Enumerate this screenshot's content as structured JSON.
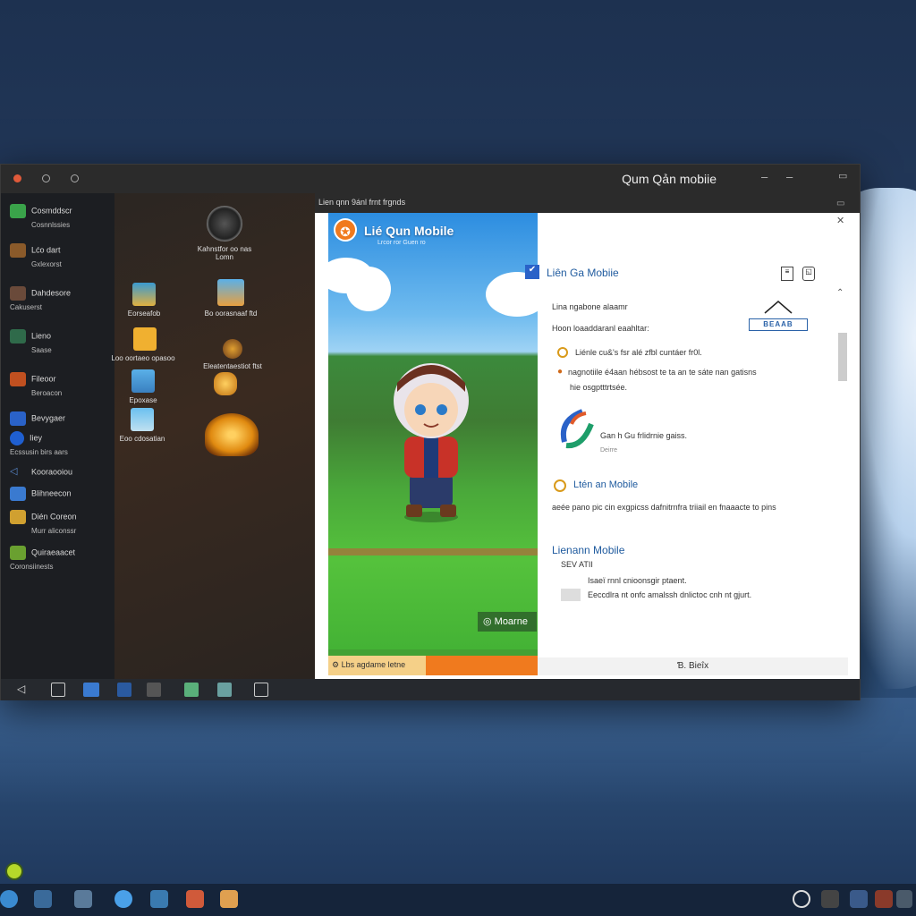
{
  "window": {
    "title": "Qum Qản mobiie"
  },
  "content_bar": {
    "text": "Lien qnn 9ánl frnt frgnds"
  },
  "sidebar": {
    "items": [
      {
        "label": "Cosmddscr",
        "sub": "Cosnnlssies"
      },
      {
        "label": "Lćo dart",
        "sub": "Gxlexorst"
      },
      {
        "label": "Dahdesore",
        "sub": "Cakuserst"
      },
      {
        "label": "Lieno",
        "sub": "Saase"
      },
      {
        "label": "Fileoor",
        "sub": "Beroacon"
      },
      {
        "label": "Bevygaer",
        "sub": ""
      },
      {
        "label": "Iiey",
        "sub": "Ecssusin birs aars"
      },
      {
        "label": "Kooraooiou",
        "sub": ""
      },
      {
        "label": "Blihneecon",
        "sub": ""
      },
      {
        "label": "Dién Coreon",
        "sub": "Murr aliconssr"
      },
      {
        "label": "Quiraeaacet",
        "sub": "Coronsiinests"
      }
    ]
  },
  "desktop": {
    "icons": [
      {
        "label": "Kahnstfor oo nas"
      },
      {
        "label": "Lomn"
      },
      {
        "label": "Eorseafob"
      },
      {
        "label": "Bo oorasnaaf ftd"
      },
      {
        "label": "Loo oortaeo opasoo"
      },
      {
        "label": "Eleatentaestiot ftst"
      },
      {
        "label": "Epoxase"
      },
      {
        "label": "Eoo cdosatian"
      }
    ]
  },
  "game": {
    "title": "Lié Qun Mobile",
    "subtitle": "Lrcor ror Guen ro",
    "more_label": "Moarne",
    "bar_label": "Lbs agdame letne"
  },
  "panel": {
    "title1": "Liên Ga Mobiie",
    "line1": "Lina ngabone alaamr",
    "line2": "Hoon loaaddaranl eaahltar:",
    "badge": "BEAAB",
    "bullet1": "Liénle cu&'s fsr alé zfbl cuntáer fr0l.",
    "bullet2": "nagnotiile é4aan hébsost te ta an te sáte nan gatisns",
    "bullet2b": "hie osgptttrtsée.",
    "partner": "Gan h Gu frlidrnie gaiss.",
    "partner_sub": "Deirre",
    "title2": "Ltén an Mobile",
    "line3": "aeée pano pic cin exgpicss dafnitrnfra triiail en fnaaacte to pins",
    "title3": "Lienann Mobile",
    "line4": "SEV ATII",
    "line5": "Isaeï rnnl cnioonsgir ptaent.",
    "line6": "Eeccdlra nt onfc amalssh dnlictoc cnh nt gjurt.",
    "status": "Ɓ.  Bieîx"
  },
  "colors": {
    "accent": "#1e5a9e",
    "orange": "#f07a1e",
    "close_dot": "#e05a3a"
  }
}
